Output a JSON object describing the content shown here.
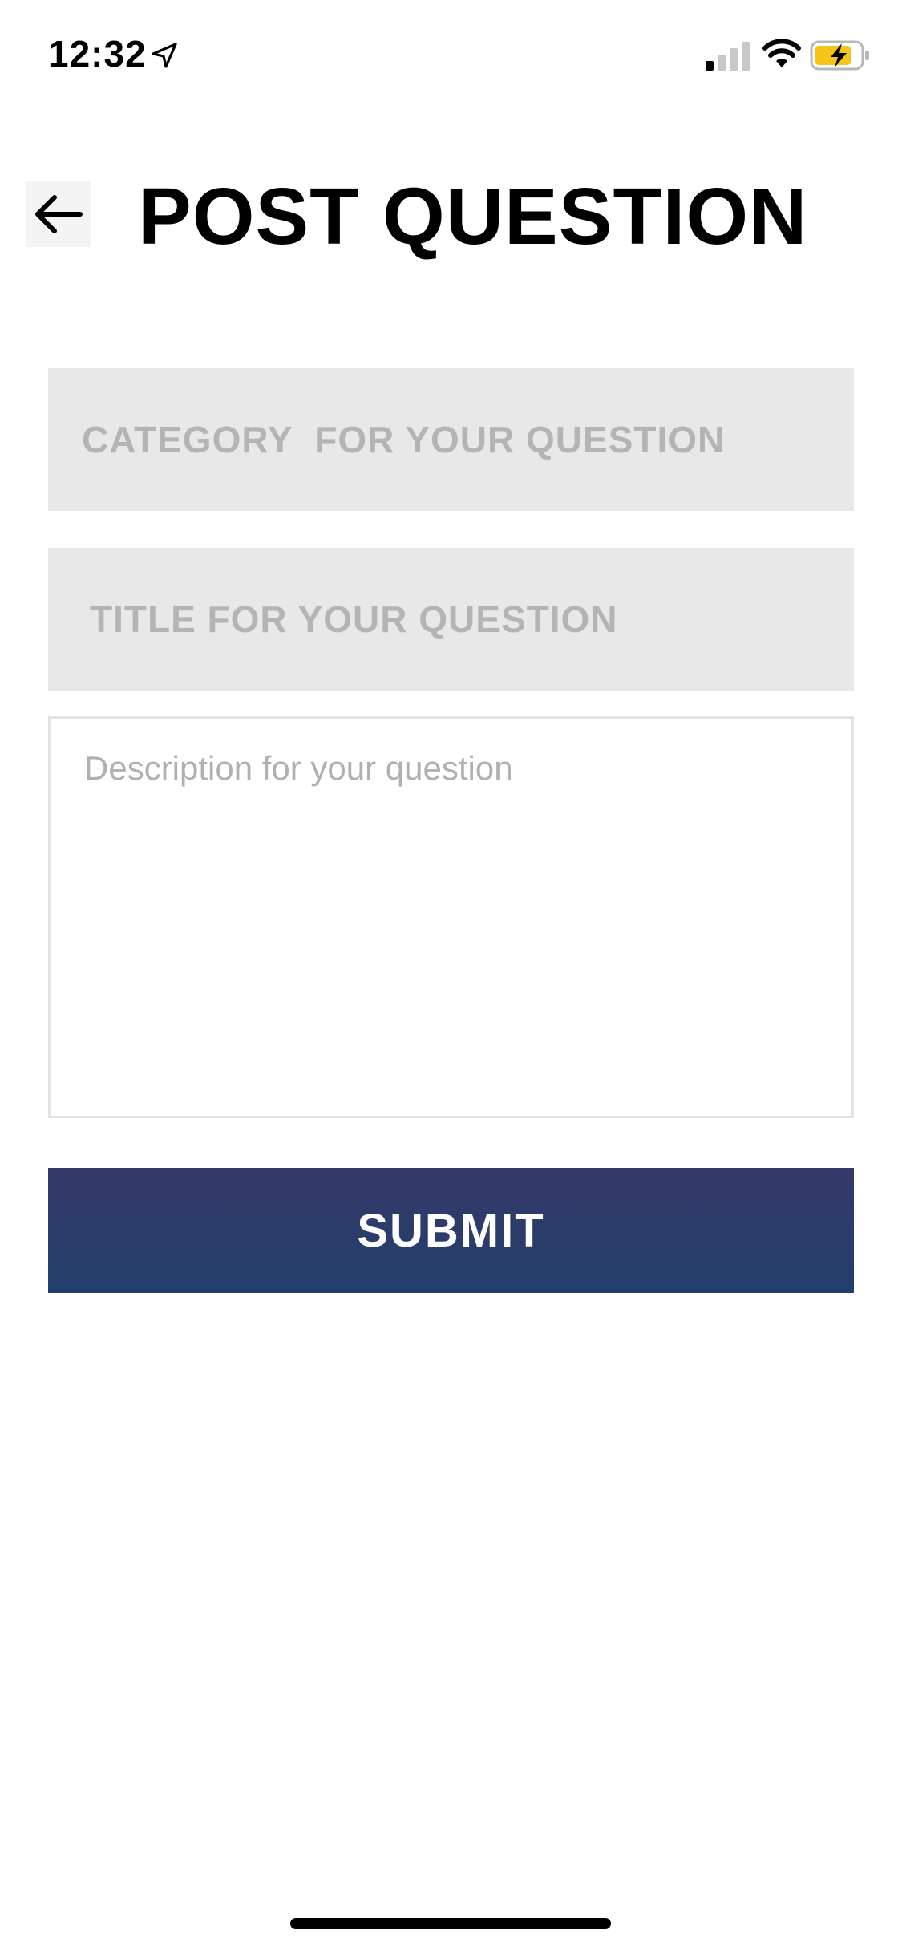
{
  "status_bar": {
    "time": "12:32",
    "location_icon": "location-arrow-icon",
    "signal_icon": "cellular-signal-icon",
    "wifi_icon": "wifi-icon",
    "battery_icon": "battery-charging-icon",
    "battery_color": "#f5c518"
  },
  "header": {
    "back_icon": "arrow-left-icon",
    "title": "POST QUESTION"
  },
  "form": {
    "category": {
      "value": "",
      "placeholder": "CATEGORY  FOR YOUR QUESTION"
    },
    "title": {
      "value": "",
      "placeholder": "TITLE FOR YOUR QUESTION"
    },
    "description": {
      "value": "",
      "placeholder": "Description for your question"
    },
    "submit_label": "SUBMIT"
  },
  "colors": {
    "submit_background": "#2b3c6b",
    "field_background": "#e8e8e8",
    "placeholder": "#b4b4b4"
  }
}
